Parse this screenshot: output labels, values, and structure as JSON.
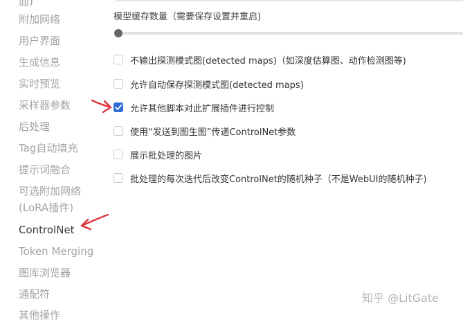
{
  "sidebar": {
    "items": [
      {
        "label": "面)",
        "active": false
      },
      {
        "label": "附加网络",
        "active": false
      },
      {
        "label": "用户界面",
        "active": false
      },
      {
        "label": "生成信息",
        "active": false
      },
      {
        "label": "实时预览",
        "active": false
      },
      {
        "label": "采样器参数",
        "active": false
      },
      {
        "label": "后处理",
        "active": false
      },
      {
        "label": "Tag自动填充",
        "active": false
      },
      {
        "label": "提示词融合",
        "active": false
      },
      {
        "label": "可选附加网络",
        "active": false
      },
      {
        "label": "(LoRA插件)",
        "active": false
      },
      {
        "label": "ControlNet",
        "active": true
      },
      {
        "label": "Token Merging",
        "active": false
      },
      {
        "label": "图库浏览器",
        "active": false
      },
      {
        "label": "通配符",
        "active": false
      },
      {
        "label": "其他操作",
        "active": false
      }
    ]
  },
  "settings": {
    "slider_label": "模型缓存数量（需要保存设置并重启)",
    "slider_value_fraction": 0,
    "options": [
      {
        "label": "不输出探测模式图(detected maps)（如深度估算图、动作检测图等)",
        "checked": false
      },
      {
        "label": "允许自动保存探测模式图(detected maps)",
        "checked": false
      },
      {
        "label": "允许其他脚本对此扩展插件进行控制",
        "checked": true
      },
      {
        "label": "使用“发送到图生图”传递ControlNet参数",
        "checked": false
      },
      {
        "label": "展示批处理的图片",
        "checked": false
      },
      {
        "label": "批处理的每次迭代后改变ControlNet的随机种子（不是WebUI的随机种子)",
        "checked": false
      }
    ]
  },
  "annotations": {
    "arrow_color": "#e0353c"
  },
  "colors": {
    "accent": "#2f6bd8"
  },
  "watermark": {
    "text": "知乎 @LitGate"
  }
}
